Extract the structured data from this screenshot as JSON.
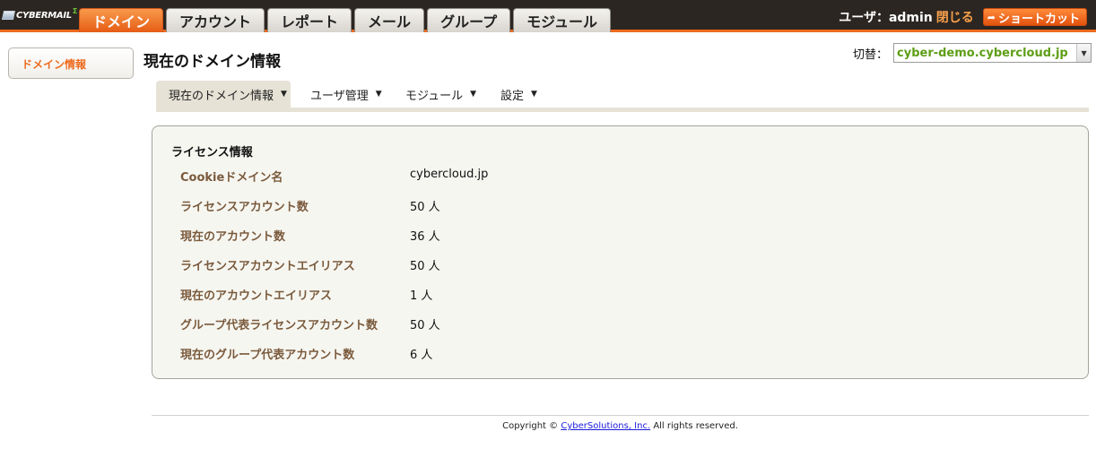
{
  "header": {
    "logo_text": "CYBERMAIL",
    "logo_sup": "Σ",
    "tabs": [
      {
        "label": "ドメイン"
      },
      {
        "label": "アカウント"
      },
      {
        "label": "レポート"
      },
      {
        "label": "メール"
      },
      {
        "label": "グループ"
      },
      {
        "label": "モジュール"
      }
    ],
    "user_label": "ユーザ：admin",
    "logout": "閉じる",
    "shortcut": "ショートカット"
  },
  "sidebar": {
    "items": [
      {
        "label": "ドメイン情報"
      }
    ]
  },
  "main": {
    "title": "現在のドメイン情報",
    "switch_label": "切替：",
    "domain_select": "cyber-demo.cybercloud.jp",
    "submenu": [
      {
        "label": "現在のドメイン情報"
      },
      {
        "label": "ユーザ管理"
      },
      {
        "label": "モジュール"
      },
      {
        "label": "設定"
      }
    ],
    "license": {
      "title": "ライセンス情報",
      "rows": [
        {
          "label": "Cookieドメイン名",
          "value": "cybercloud.jp"
        },
        {
          "label": "ライセンスアカウント数",
          "value": "50 人"
        },
        {
          "label": "現在のアカウント数",
          "value": "36 人"
        },
        {
          "label": "ライセンスアカウントエイリアス",
          "value": "50 人"
        },
        {
          "label": "現在のアカウントエイリアス",
          "value": "1 人"
        },
        {
          "label": "グループ代表ライセンスアカウント数",
          "value": "50 人"
        },
        {
          "label": "現在のグループ代表アカウント数",
          "value": "6 人"
        }
      ]
    }
  },
  "footer": {
    "prefix": "Copyright ©",
    "link": "CyberSolutions, Inc.",
    "suffix": "All rights reserved."
  },
  "colors": {
    "accent": "#ee6a1f",
    "topbar": "#2b2621",
    "domain_text": "#5e9e16",
    "label_text": "#7a5a3c"
  }
}
